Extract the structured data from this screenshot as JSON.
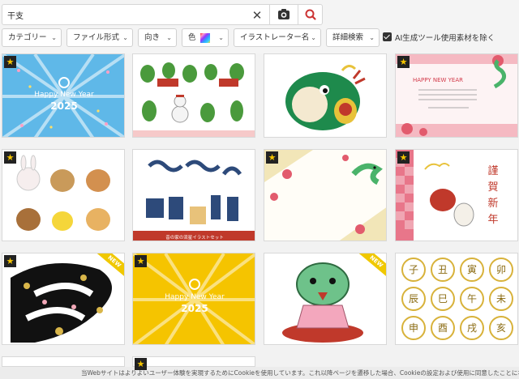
{
  "search": {
    "value": "干支",
    "placeholder": ""
  },
  "filters": [
    {
      "label": "カテゴリー"
    },
    {
      "label": "ファイル形式"
    },
    {
      "label": "向き"
    },
    {
      "label": "色"
    },
    {
      "label": "イラストレーター名"
    },
    {
      "label": "詳細検索"
    }
  ],
  "ai_exclude": {
    "label": "AI生成ツール使用素材を除く",
    "checked": true
  },
  "cards": [
    {
      "star": true,
      "text": "Happy New Year",
      "year": "2025"
    },
    {
      "star": false
    },
    {
      "star": false
    },
    {
      "star": true,
      "text": "HAPPY NEW YEAR"
    },
    {
      "star": true
    },
    {
      "star": false,
      "caption": "昔の家の流星イラストセット"
    },
    {
      "star": true
    },
    {
      "star": true,
      "vertical": [
        "謹",
        "賀",
        "新",
        "年"
      ]
    },
    {
      "star": true,
      "new": true
    },
    {
      "star": true,
      "text": "Happy New Year",
      "year": "2025"
    },
    {
      "star": false,
      "new": true
    },
    {
      "star": false,
      "kanji": [
        "子",
        "丑",
        "寅",
        "卯",
        "辰",
        "巳",
        "午",
        "未",
        "申",
        "酉",
        "戌",
        "亥"
      ]
    }
  ],
  "badge": {
    "new": "NEW",
    "star": "★"
  },
  "cookie": "当Webサイトはよりよいユーザー体験を実現するためにCookieを使用しています。これ以降ページを遷移した場合、Cookieの設定および使用に同意したことになります。",
  "colors": {
    "accent": "#cc3333",
    "star_bg": "#222222",
    "star_fg": "#f5c400",
    "new_bg": "#f0c800"
  }
}
